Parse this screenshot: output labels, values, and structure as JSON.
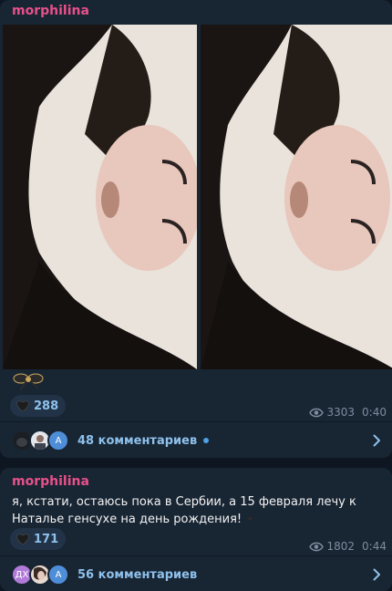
{
  "posts": [
    {
      "author": "morphilina",
      "reaction_count": "288",
      "views": "3303",
      "time": "0:40",
      "comments_label": "48 комментариев",
      "avatars": [
        {
          "initials": "",
          "color": "#2a2f36"
        },
        {
          "initials": "",
          "color": "#cfd4da"
        },
        {
          "initials": "A",
          "color": "#4e8ed8"
        }
      ]
    },
    {
      "author": "morphilina",
      "text": "я, кстати, остаюсь пока в Сербии, а 15 февраля лечу к Наталье генсухе на день рождения! ",
      "reaction_count": "171",
      "views": "1802",
      "time": "0:44",
      "comments_label": "56 комментариев",
      "avatars": [
        {
          "initials": "ДХ",
          "color": "#b07ad8"
        },
        {
          "initials": "",
          "color": "#d8c7bd"
        },
        {
          "initials": "A",
          "color": "#4e8ed8"
        }
      ]
    }
  ],
  "colors": {
    "background": "#0e1621",
    "bubble": "#182533",
    "author": "#e8508a",
    "link": "#8ec1ec",
    "meta": "#7d8d9f"
  },
  "icons": [
    "heart-icon",
    "eye-icon",
    "chevron-right-icon",
    "black-heart-emoji",
    "bow-sticker"
  ]
}
